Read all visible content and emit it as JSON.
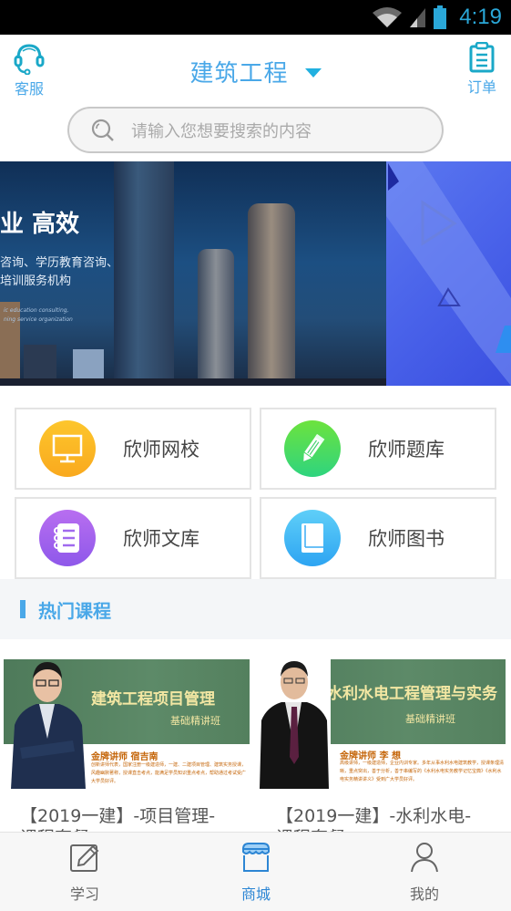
{
  "status_bar": {
    "time": "4:19"
  },
  "header": {
    "left_button": {
      "label": "客服",
      "icon": "headset-icon"
    },
    "title": "建筑工程",
    "right_button": {
      "label": "订单",
      "icon": "clipboard-icon"
    }
  },
  "search": {
    "placeholder": "请输入您想要搜索的内容",
    "value": ""
  },
  "banner": {
    "headline": "业 高效",
    "line1": "咨询、学历教育咨询、",
    "line2": "培训服务机构",
    "en1": "ic education consulting,",
    "en2": "ning service organization"
  },
  "quick_links": [
    {
      "label": "欣师网校",
      "icon": "monitor-icon",
      "color": "#fbb52a"
    },
    {
      "label": "欣师题库",
      "icon": "pencil-icon",
      "color": "#3dd35f"
    },
    {
      "label": "欣师文库",
      "icon": "notebook-icon",
      "color": "#a466ee"
    },
    {
      "label": "欣师图书",
      "icon": "book-icon",
      "color": "#3aacf4"
    }
  ],
  "hot_section": {
    "title": "热门课程"
  },
  "courses": [
    {
      "poster_title": "建筑工程项目管理",
      "poster_subtitle": "基础精讲班",
      "teacher": "金牌讲师 宿吉南",
      "teacher_desc": "创新讲师代表，国家注册一级建造师，一建、二建项目管理、建筑实务授课，风趣幽默著称，授课直击考点，能满足学员知识重点考点，帮助通过考试受广大学员好评。",
      "title_line1": "【2019一建】-项目管理-",
      "title_line2": "课程套餐"
    },
    {
      "poster_title": "水利水电工程管理与实务",
      "poster_subtitle": "基础精讲班",
      "teacher": "金牌讲师 李 想",
      "teacher_desc": "高级讲师，一级建造师，企业内训专家。多年从事水利水电建筑教学，授课条理清晰，重点突出，善于分析，善于串编写的《水利水电实务教学记忆宝典》《水利水电实务精讲讲义》受到广大学员好评。",
      "title_line1": "【2019一建】-水利水电-",
      "title_line2": "课程套餐"
    }
  ],
  "tabbar": {
    "tabs": [
      {
        "label": "学习",
        "icon": "edit-icon",
        "active": false
      },
      {
        "label": "商城",
        "icon": "store-icon",
        "active": true
      },
      {
        "label": "我的",
        "icon": "user-icon",
        "active": false
      }
    ]
  },
  "colors": {
    "accent": "#4aa8e8",
    "active_tab": "#2d86d4"
  }
}
